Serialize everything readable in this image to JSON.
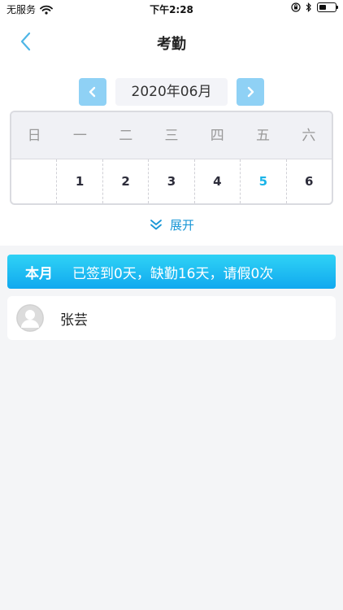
{
  "status_bar": {
    "carrier": "无服务",
    "time": "下午2:28"
  },
  "nav": {
    "title": "考勤"
  },
  "calendar": {
    "month_label": "2020年06月",
    "weekdays": [
      "日",
      "一",
      "二",
      "三",
      "四",
      "五",
      "六"
    ],
    "days": [
      "",
      "1",
      "2",
      "3",
      "4",
      "5",
      "6"
    ],
    "today": "5"
  },
  "expand": {
    "label": "展开"
  },
  "summary": {
    "label": "本月",
    "text": "已签到0天，缺勤16天，请假0次"
  },
  "employee": {
    "name": "张芸"
  },
  "colors": {
    "accent": "#1ab4e8",
    "arrow_button_bg": "#8fd1f5",
    "summary_gradient_top": "#2fd2f5",
    "summary_gradient_bottom": "#11a9ef"
  },
  "icons": {
    "back": "chevron-left-icon",
    "prev": "chevron-left-icon",
    "next": "chevron-right-icon",
    "expand": "double-chevron-down-icon",
    "avatar": "person-icon"
  }
}
